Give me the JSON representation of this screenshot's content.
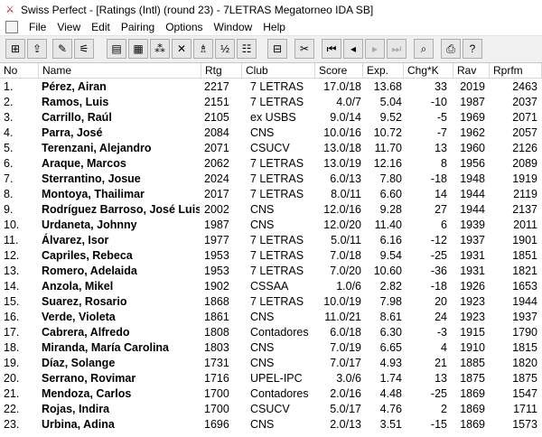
{
  "window": {
    "title": "Swiss Perfect - [Ratings (Intl)  (round 23) - 7LETRAS Megatorneo IDA SB]",
    "app_icon": "knight-crossed-swords-icon"
  },
  "menu": [
    "File",
    "View",
    "Edit",
    "Pairing",
    "Options",
    "Window",
    "Help"
  ],
  "toolbar": {
    "buttons": [
      {
        "icon": "new-tournament-icon",
        "glyph": "⊞"
      },
      {
        "icon": "open-tournament-icon",
        "glyph": "⇪"
      },
      {
        "icon": "edit-icon",
        "glyph": "✎"
      },
      {
        "icon": "wizard-icon",
        "glyph": "⚟"
      },
      {
        "icon": "scorecard-icon",
        "glyph": "▤"
      },
      {
        "icon": "crosstable-icon",
        "glyph": "▦"
      },
      {
        "icon": "pairings-icon",
        "glyph": "⁂"
      },
      {
        "icon": "results-icon",
        "glyph": "✕"
      },
      {
        "icon": "rating-icon",
        "glyph": "♗"
      },
      {
        "icon": "ranking-icon",
        "glyph": "½"
      },
      {
        "icon": "print-layout-icon",
        "glyph": "☷"
      },
      {
        "icon": "grid-icon",
        "glyph": "⊟"
      },
      {
        "icon": "scissors-icon",
        "glyph": "✂"
      },
      {
        "icon": "first-icon",
        "glyph": "⏮"
      },
      {
        "icon": "prev-icon",
        "glyph": "◂"
      },
      {
        "icon": "next-icon",
        "glyph": "▸"
      },
      {
        "icon": "last-icon",
        "glyph": "⏭"
      },
      {
        "icon": "preview-icon",
        "glyph": "⌕"
      },
      {
        "icon": "print-icon",
        "glyph": "⎙"
      },
      {
        "icon": "help-icon",
        "glyph": "?"
      }
    ]
  },
  "columns": [
    "No",
    "Name",
    "Rtg",
    "Club",
    "Score",
    "Exp.",
    "Chg*K",
    "Rav",
    "Rprfm"
  ],
  "rows": [
    [
      "1.",
      "Pérez, Airan",
      "2217",
      "7 LETRAS",
      "17.0/18",
      "13.68",
      "33",
      "2019",
      "2463"
    ],
    [
      "2.",
      "Ramos, Luis",
      "2151",
      "7 LETRAS",
      "4.0/7",
      "5.04",
      "-10",
      "1987",
      "2037"
    ],
    [
      "3.",
      "Carrillo, Raúl",
      "2105",
      "ex USBS",
      "9.0/14",
      "9.52",
      "-5",
      "1969",
      "2071"
    ],
    [
      "4.",
      "Parra, José",
      "2084",
      "CNS",
      "10.0/16",
      "10.72",
      "-7",
      "1962",
      "2057"
    ],
    [
      "5.",
      "Terenzani, Alejandro",
      "2071",
      "CSUCV",
      "13.0/18",
      "11.70",
      "13",
      "1960",
      "2126"
    ],
    [
      "6.",
      "Araque, Marcos",
      "2062",
      "7 LETRAS",
      "13.0/19",
      "12.16",
      "8",
      "1956",
      "2089"
    ],
    [
      "7.",
      "Sterrantino, Josue",
      "2024",
      "7 LETRAS",
      "6.0/13",
      "7.80",
      "-18",
      "1948",
      "1919"
    ],
    [
      "8.",
      "Montoya, Thailimar",
      "2017",
      "7 LETRAS",
      "8.0/11",
      "6.60",
      "14",
      "1944",
      "2119"
    ],
    [
      "9.",
      "Rodríguez Barroso, José Luis",
      "2002",
      "CNS",
      "12.0/16",
      "9.28",
      "27",
      "1944",
      "2137"
    ],
    [
      "10.",
      "Urdaneta, Johnny",
      "1987",
      "CNS",
      "12.0/20",
      "11.40",
      "6",
      "1939",
      "2011"
    ],
    [
      "11.",
      "Álvarez, Isor",
      "1977",
      "7 LETRAS",
      "5.0/11",
      "6.16",
      "-12",
      "1937",
      "1901"
    ],
    [
      "12.",
      "Capriles, Rebeca",
      "1953",
      "7 LETRAS",
      "7.0/18",
      "9.54",
      "-25",
      "1931",
      "1851"
    ],
    [
      "13.",
      "Romero, Adelaida",
      "1953",
      "7 LETRAS",
      "7.0/20",
      "10.60",
      "-36",
      "1931",
      "1821"
    ],
    [
      "14.",
      "Anzola, Mikel",
      "1902",
      "CSSAA",
      "1.0/6",
      "2.82",
      "-18",
      "1926",
      "1653"
    ],
    [
      "15.",
      "Suarez, Rosario",
      "1868",
      "7 LETRAS",
      "10.0/19",
      "7.98",
      "20",
      "1923",
      "1944"
    ],
    [
      "16.",
      "Verde, Violeta",
      "1861",
      "CNS",
      "11.0/21",
      "8.61",
      "24",
      "1923",
      "1937"
    ],
    [
      "17.",
      "Cabrera, Alfredo",
      "1808",
      "Contadores",
      "6.0/18",
      "6.30",
      "-3",
      "1915",
      "1790"
    ],
    [
      "18.",
      "Miranda, María Carolina",
      "1803",
      "CNS",
      "7.0/19",
      "6.65",
      "4",
      "1910",
      "1815"
    ],
    [
      "19.",
      "Díaz, Solange",
      "1731",
      "CNS",
      "7.0/17",
      "4.93",
      "21",
      "1885",
      "1820"
    ],
    [
      "20.",
      "Serrano, Rovimar",
      "1716",
      "UPEL-IPC",
      "3.0/6",
      "1.74",
      "13",
      "1875",
      "1875"
    ],
    [
      "21.",
      "Mendoza, Carlos",
      "1700",
      "Contadores",
      "2.0/16",
      "4.48",
      "-25",
      "1869",
      "1547"
    ],
    [
      "22.",
      "Rojas, Indira",
      "1700",
      "CSUCV",
      "5.0/17",
      "4.76",
      "2",
      "1869",
      "1711"
    ],
    [
      "23.",
      "Urbina, Adina",
      "1696",
      "CNS",
      "2.0/13",
      "3.51",
      "-15",
      "1869",
      "1573"
    ]
  ]
}
